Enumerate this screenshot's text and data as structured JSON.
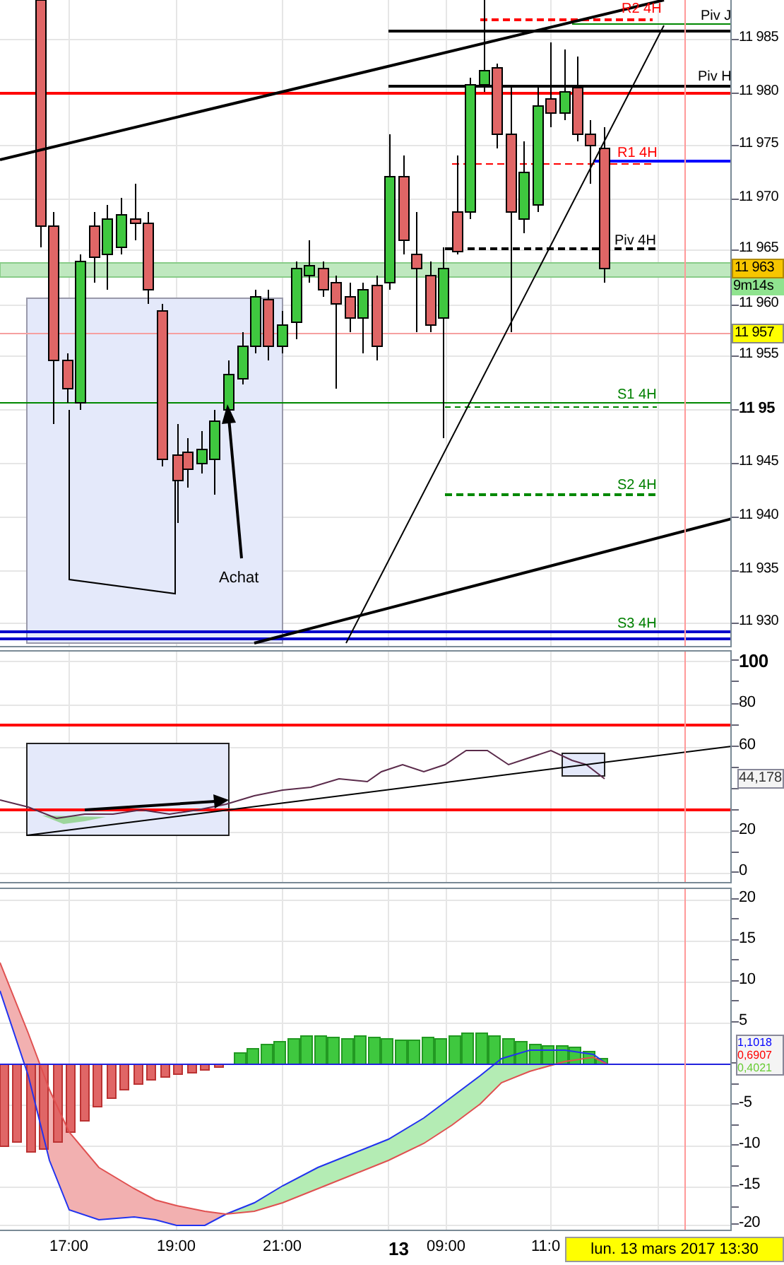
{
  "price_panel": {
    "axis_labels": [
      {
        "text": "11 985",
        "bold": false
      },
      {
        "text": "11 980",
        "bold": false
      },
      {
        "text": "11 975",
        "bold": false
      },
      {
        "text": "11 970",
        "bold": false
      },
      {
        "text": "11 965",
        "bold": false
      },
      {
        "text": "11 960",
        "bold": false
      },
      {
        "text": "11 955",
        "bold": false
      },
      {
        "text": "11 95",
        "bold": true
      },
      {
        "text": "11 945",
        "bold": false
      },
      {
        "text": "11 940",
        "bold": false
      },
      {
        "text": "11 935",
        "bold": false
      },
      {
        "text": "11 930",
        "bold": false
      }
    ],
    "price_badges": [
      {
        "text": "11 963",
        "kind": "last"
      },
      {
        "text": "9m14s",
        "kind": "timer"
      },
      {
        "text": "11 957",
        "kind": "level"
      }
    ],
    "line_labels": [
      {
        "text": "R2 4H",
        "color": "#ff0000"
      },
      {
        "text": "Piv J",
        "color": "#000000"
      },
      {
        "text": "Piv H",
        "color": "#000000"
      },
      {
        "text": "R1 4H",
        "color": "#ff0000"
      },
      {
        "text": "Piv 4H",
        "color": "#000000"
      },
      {
        "text": "S1 4H",
        "color": "#008000"
      },
      {
        "text": "S2 4H",
        "color": "#008000"
      },
      {
        "text": "S3 4H",
        "color": "#008000"
      }
    ],
    "annotation": "Achat"
  },
  "rsi_panel": {
    "axis_labels": [
      {
        "text": "100",
        "bold": true
      },
      {
        "text": "80",
        "bold": false
      },
      {
        "text": "60",
        "bold": false
      },
      {
        "text": "20",
        "bold": false
      },
      {
        "text": "0",
        "bold": false
      }
    ],
    "value_badge": "44,178"
  },
  "macd_panel": {
    "axis_labels": [
      {
        "text": "20",
        "bold": false
      },
      {
        "text": "15",
        "bold": false
      },
      {
        "text": "10",
        "bold": false
      },
      {
        "text": "5",
        "bold": false
      },
      {
        "text": "-5",
        "bold": false
      },
      {
        "text": "-10",
        "bold": false
      },
      {
        "text": "-15",
        "bold": false
      },
      {
        "text": "-20",
        "bold": false
      }
    ],
    "value_badges": [
      {
        "text": "1,1018",
        "color": "#0000ff"
      },
      {
        "text": "0,6907",
        "color": "#ff0000"
      },
      {
        "text": "0,4021",
        "color": "#66cc33"
      }
    ]
  },
  "time_axis": {
    "labels": [
      {
        "text": "17:00",
        "bold": false
      },
      {
        "text": "19:00",
        "bold": false
      },
      {
        "text": "21:00",
        "bold": false
      },
      {
        "text": "13",
        "bold": true
      },
      {
        "text": "09:00",
        "bold": false
      },
      {
        "text": "11:0",
        "bold": false
      }
    ],
    "cursor_badge": "lun. 13 mars 2017 13:30"
  }
}
